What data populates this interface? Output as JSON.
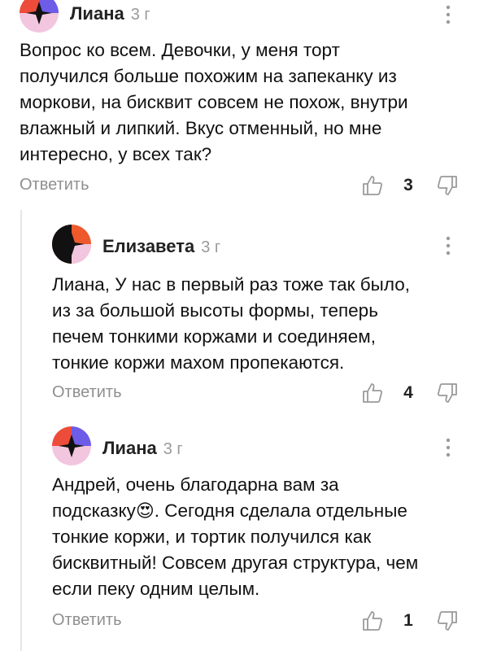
{
  "comments": [
    {
      "author": "Лиана",
      "time": "3 г",
      "avatar_colors": {
        "bg": "#f2c6de",
        "left": "#ee4c3a",
        "right": "#6c5ce7",
        "star": "#111111"
      },
      "text_lines": [
        "Вопрос ко всем. Девочки, у меня торт",
        "получился больше похожим на запеканку из",
        "моркови, на бисквит совсем не похож, внутри",
        "влажный и липкий. Вкус отменный, но мне",
        "интересно, у всех так?"
      ],
      "reply_label": "Ответить",
      "likes": "3"
    },
    {
      "author": "Елизавета",
      "time": "3 г",
      "avatar_colors": {
        "bg": "#ee5a2c",
        "left": "#111111",
        "right": "#f2c6de",
        "star": "#111111"
      },
      "text_lines": [
        "Лиана, У нас в первый раз тоже так было,",
        "из за большой высоты формы, теперь",
        "печем тонкими коржами и соединяем,",
        "тонкие коржи махом пропекаются."
      ],
      "reply_label": "Ответить",
      "likes": "4"
    },
    {
      "author": "Лиана",
      "time": "3 г",
      "avatar_colors": {
        "bg": "#f2c6de",
        "left": "#ee4c3a",
        "right": "#6c5ce7",
        "star": "#111111"
      },
      "text_lines": [
        "Андрей, очень благодарна вам за",
        "подсказку",
        "тонкие коржи, и тортик получился как",
        "бисквитный! Совсем другая структура, чем",
        "если пеку одним целым."
      ],
      "line2_emoji": "😍",
      "line2_rest": ". Сегодня сделала отдельные",
      "reply_label": "Ответить",
      "likes": "1"
    }
  ],
  "icons": {
    "like": "thumbs-up-icon",
    "dislike": "thumbs-down-icon",
    "menu": "more-vertical-icon"
  }
}
